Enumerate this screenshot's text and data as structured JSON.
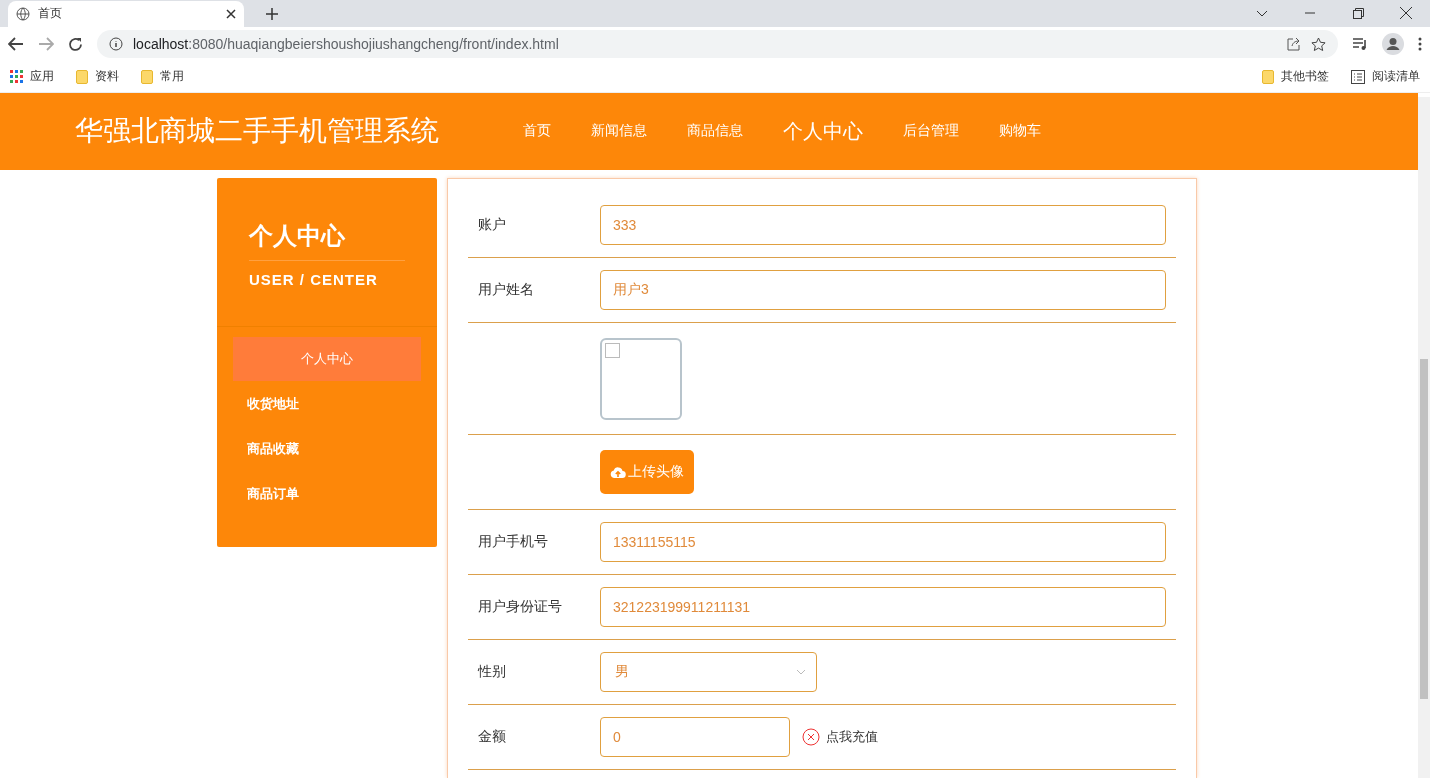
{
  "browser": {
    "tabs": [
      {
        "title": "首页",
        "selected": true
      }
    ],
    "url_host": "localhost",
    "url_rest": ":8080/huaqiangbeiershoushojiushangcheng/front/index.html",
    "bookmarks": [
      {
        "label": "应用",
        "kind": "apps"
      },
      {
        "label": "资料",
        "kind": "folder"
      },
      {
        "label": "常用",
        "kind": "folder"
      }
    ],
    "bookmarks_right": [
      {
        "label": "其他书签",
        "kind": "folder"
      },
      {
        "label": "阅读清单",
        "kind": "reading"
      }
    ]
  },
  "header": {
    "title": "华强北商城二手手机管理系统",
    "nav": [
      {
        "label": "首页",
        "selected": false
      },
      {
        "label": "新闻信息",
        "selected": false
      },
      {
        "label": "商品信息",
        "selected": false
      },
      {
        "label": "个人中心",
        "selected": true
      },
      {
        "label": "后台管理",
        "selected": false
      },
      {
        "label": "购物车",
        "selected": false
      }
    ]
  },
  "sidebar": {
    "title": "个人中心",
    "subtitle": "USER / CENTER",
    "items": [
      {
        "label": "个人中心",
        "selected": true
      },
      {
        "label": "收货地址",
        "selected": false
      },
      {
        "label": "商品收藏",
        "selected": false
      },
      {
        "label": "商品订单",
        "selected": false
      }
    ]
  },
  "form": {
    "rows": [
      {
        "kind": "input",
        "label": "账户",
        "value": "333"
      },
      {
        "kind": "input",
        "label": "用户姓名",
        "value": "用户3"
      },
      {
        "kind": "image"
      },
      {
        "kind": "upload",
        "button": "上传头像"
      },
      {
        "kind": "input",
        "label": "用户手机号",
        "value": "13311155115"
      },
      {
        "kind": "input",
        "label": "用户身份证号",
        "value": "321223199911211131"
      },
      {
        "kind": "select",
        "label": "性别",
        "value": "男"
      },
      {
        "kind": "balance",
        "label": "金额",
        "value": "0",
        "action": "点我充值"
      }
    ]
  }
}
